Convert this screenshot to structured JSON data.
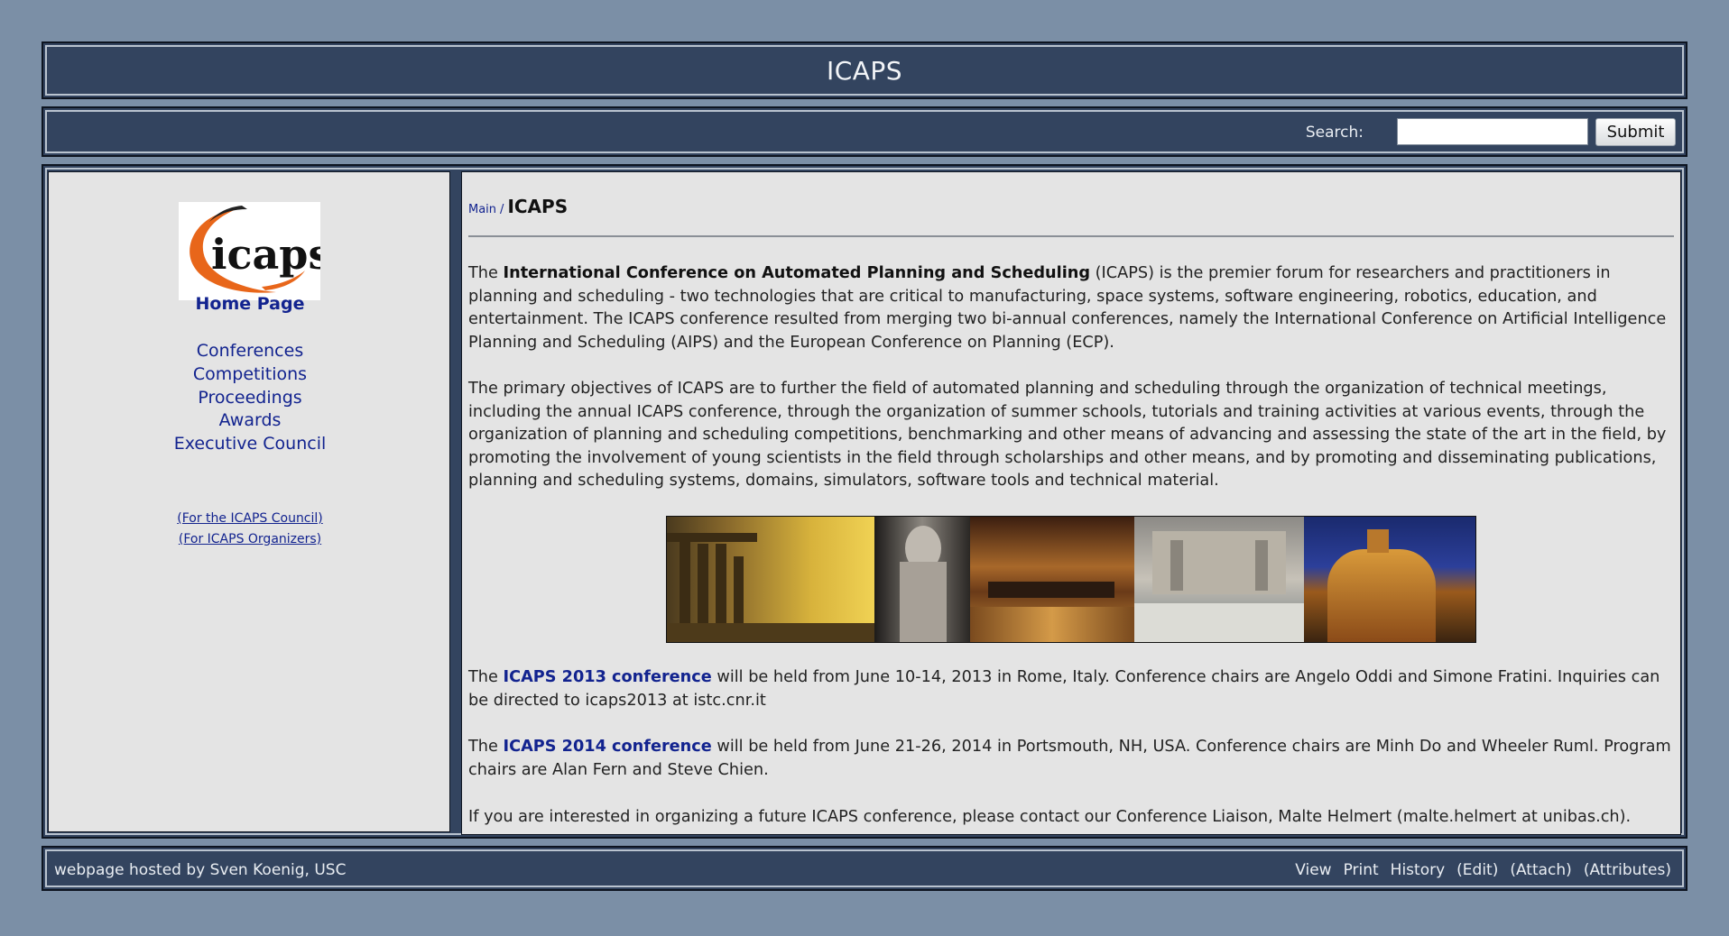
{
  "header": {
    "title": "ICAPS"
  },
  "search": {
    "label": "Search:",
    "value": "",
    "button": "Submit"
  },
  "sidebar": {
    "logo_text": "icaps",
    "home": "Home Page",
    "links": [
      "Conferences",
      "Competitions",
      "Proceedings",
      "Awards",
      "Executive Council"
    ],
    "small_links": [
      "(For the ICAPS Council)",
      "(For ICAPS Organizers)"
    ]
  },
  "content": {
    "breadcrumb": "Main",
    "breadcrumb_sep": "/",
    "title": "ICAPS",
    "p1": {
      "before": "The ",
      "bold": "International Conference on Automated Planning and Scheduling",
      "after": " (ICAPS) is the premier forum for researchers and practitioners in planning and scheduling - two technologies that are critical to manufacturing, space systems, software engineering, robotics, education, and entertainment. The ICAPS conference resulted from merging two bi-annual conferences, namely the International Conference on Artificial Intelligence Planning and Scheduling (AIPS) and the European Conference on Planning (ECP)."
    },
    "p2": "The primary objectives of ICAPS are to further the field of automated planning and scheduling through the organization of technical meetings, including the annual ICAPS conference, through the organization of summer schools, tutorials and training activities at various events, through the organization of planning and scheduling competitions, benchmarking and other means of advancing and assessing the state of the art in the field, by promoting the involvement of young scientists in the field through scholarships and other means, and by promoting and disseminating publications, planning and scheduling systems, domains, simulators, software tools and technical material.",
    "p3": {
      "before": "The ",
      "link": "ICAPS 2013 conference",
      "after": " will be held from June 10-14, 2013 in Rome, Italy. Conference chairs are Angelo Oddi and Simone Fratini. Inquiries can be directed to icaps2013 at istc.cnr.it"
    },
    "p4": {
      "before": "The ",
      "link": "ICAPS 2014 conference",
      "after": " will be held from June 21-26, 2014 in Portsmouth, NH, USA. Conference chairs are Minh Do and Wheeler Ruml. Program chairs are Alan Fern and Steve Chien."
    },
    "p5": "If you are interested in organizing a future ICAPS conference, please contact our Conference Liaison, Malte Helmert (malte.helmert at unibas.ch)."
  },
  "footer": {
    "credit": "webpage hosted by Sven Koenig, USC",
    "actions": [
      "View",
      "Print",
      "History",
      "(Edit)",
      "(Attach)",
      "(Attributes)"
    ]
  },
  "colors": {
    "page_bg": "#7b8fa6",
    "bar_bg": "#33445f",
    "panel_bg": "#e4e4e4",
    "link": "#12238f",
    "logo_orange": "#e8661a"
  }
}
